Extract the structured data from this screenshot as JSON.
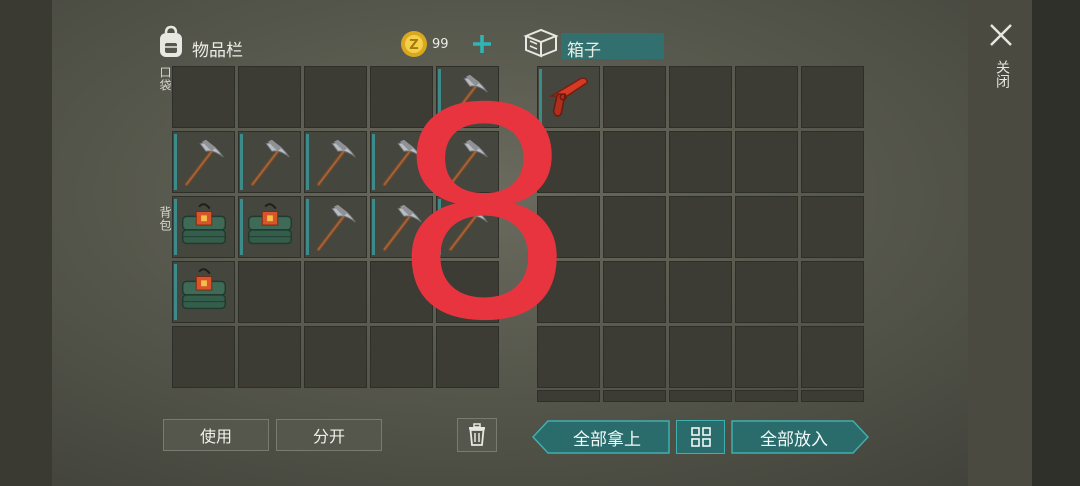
{
  "inventory": {
    "title": "物品栏",
    "coins": "99",
    "pocket_label": "口袋",
    "backpack_label": "背包",
    "rows": [
      [
        "empty",
        "empty",
        "empty",
        "empty",
        "pickaxe"
      ],
      [
        "pickaxe",
        "pickaxe",
        "pickaxe",
        "pickaxe",
        "pickaxe"
      ],
      [
        "explosive",
        "explosive",
        "pickaxe",
        "pickaxe",
        "pickaxe"
      ],
      [
        "explosive",
        "empty",
        "empty",
        "empty",
        "empty"
      ],
      [
        "empty",
        "empty",
        "empty",
        "empty",
        "empty"
      ]
    ],
    "use_label": "使用",
    "split_label": "分开"
  },
  "container": {
    "title": "箱子",
    "rows": [
      [
        "flare-gun",
        "empty",
        "empty",
        "empty",
        "empty"
      ],
      [
        "empty",
        "empty",
        "empty",
        "empty",
        "empty"
      ],
      [
        "empty",
        "empty",
        "empty",
        "empty",
        "empty"
      ],
      [
        "empty",
        "empty",
        "empty",
        "empty",
        "empty"
      ],
      [
        "empty",
        "empty",
        "empty",
        "empty",
        "empty"
      ]
    ],
    "take_all_label": "全部拿上",
    "put_all_label": "全部放入"
  },
  "close_label": "关闭",
  "overlay_digit": "8",
  "colors": {
    "accent": "#3c8b8a",
    "overlay": "#e8343f"
  }
}
